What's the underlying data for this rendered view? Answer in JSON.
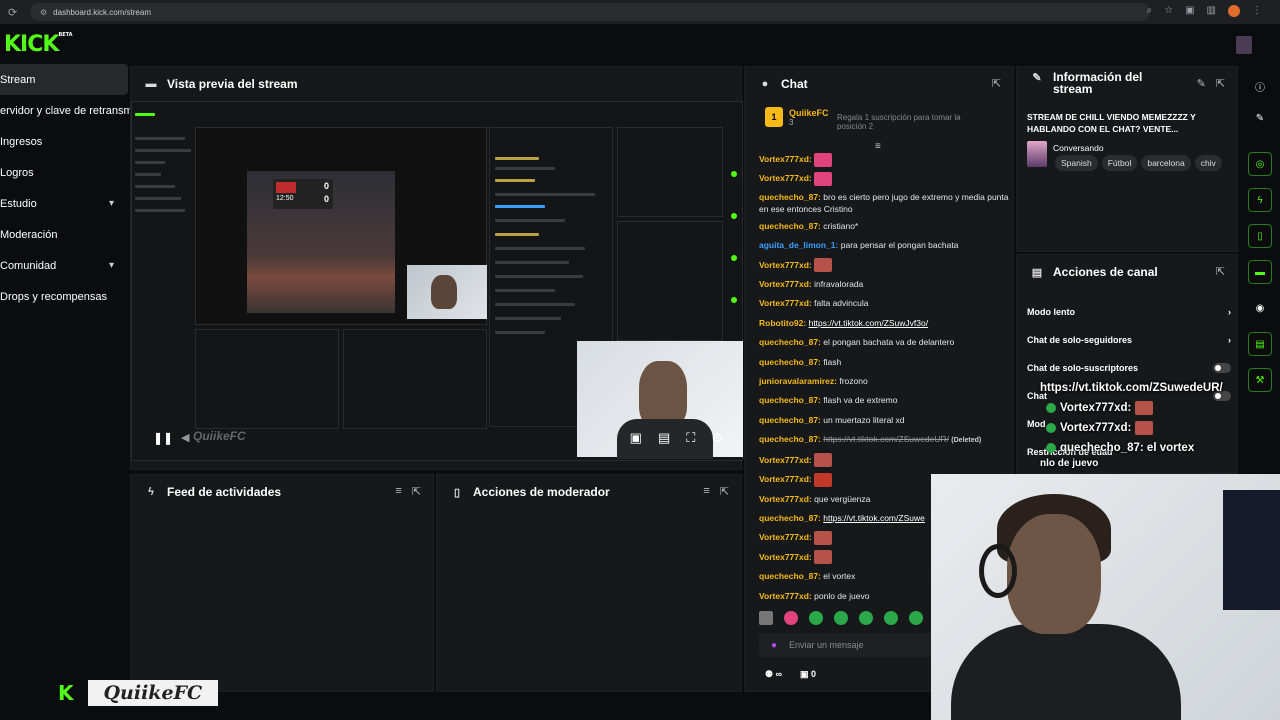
{
  "browser": {
    "url": "dashboard.kick.com/stream"
  },
  "brand": {
    "logo": "KICK",
    "beta": "BETA"
  },
  "sidebar": {
    "items": [
      {
        "label": "Stream",
        "active": true
      },
      {
        "label": "ervidor y clave de retransm"
      },
      {
        "label": "Ingresos"
      },
      {
        "label": "Logros"
      },
      {
        "label": "Estudio",
        "chevron": "▾"
      },
      {
        "label": "Moderación"
      },
      {
        "label": "Comunidad",
        "chevron": "▾"
      },
      {
        "label": "Drops y recompensas"
      }
    ]
  },
  "preview": {
    "title": "Vista previa del stream",
    "watermark": "QuiikeFC",
    "score_a": "0",
    "score_b": "0",
    "time": "12:50"
  },
  "feed": {
    "title": "Feed de actividades"
  },
  "modactions": {
    "title": "Acciones de moderador"
  },
  "chat": {
    "title": "Chat",
    "pinned": {
      "badge": "1",
      "user": "QuiikeFC",
      "count": "3",
      "gift": "Regala 1 suscripción para tomar la posición 2"
    },
    "messages": [
      {
        "user": "Vortex777xd:",
        "color": "#f5b918",
        "text": "",
        "emote": "#e0447a"
      },
      {
        "user": "Vortex777xd:",
        "color": "#f5b918",
        "text": "",
        "emote": "#e0447a"
      },
      {
        "user": "quechecho_87:",
        "color": "#f5b918",
        "text": "bro es cierto pero jugo de extremo y media punta en ese entonces Cristino",
        "wrap": true
      },
      {
        "user": "quechecho_87:",
        "color": "#f5b918",
        "text": "cristiano*"
      },
      {
        "user": "aguita_de_limon_1:",
        "color": "#3aa0ff",
        "text": "para pensar el pongan bachata"
      },
      {
        "user": "Vortex777xd:",
        "color": "#f5b918",
        "text": "",
        "emote": "#b5524a"
      },
      {
        "user": "Vortex777xd:",
        "color": "#f5b918",
        "text": "infravalorada"
      },
      {
        "user": "Vortex777xd:",
        "color": "#f5b918",
        "text": "falta advincula"
      },
      {
        "user": "Robotito92:",
        "color": "#f5b918",
        "text": "https://vt.tiktok.com/ZSuwJvf3o/",
        "link": true
      },
      {
        "user": "quechecho_87:",
        "color": "#f5b918",
        "text": "el pongan bachata va de delantero"
      },
      {
        "user": "quechecho_87:",
        "color": "#f5b918",
        "text": "flash"
      },
      {
        "user": "junioravalaramirez:",
        "color": "#f5b918",
        "text": "frozono"
      },
      {
        "user": "quechecho_87:",
        "color": "#f5b918",
        "text": "flash va de extremo"
      },
      {
        "user": "quechecho_87:",
        "color": "#f5b918",
        "text": "un muertazo literal xd"
      },
      {
        "user": "quechecho_87:",
        "color": "#f5b918",
        "text": "https://vt.tiktok.com/ZSuwedeUR/",
        "deleted": true,
        "tag": "(Deleted)"
      },
      {
        "user": "Vortex777xd:",
        "color": "#f5b918",
        "text": "",
        "emote": "#b5524a"
      },
      {
        "user": "Vortex777xd:",
        "color": "#f5b918",
        "text": "",
        "emote": "#c0392b"
      },
      {
        "user": "Vortex777xd:",
        "color": "#f5b918",
        "text": "que vergüenza"
      },
      {
        "user": "quechecho_87:",
        "color": "#f5b918",
        "text": "https://vt.tiktok.com/ZSuwe",
        "link": true
      },
      {
        "user": "Vortex777xd:",
        "color": "#f5b918",
        "text": "",
        "emote": "#b5524a"
      },
      {
        "user": "Vortex777xd:",
        "color": "#f5b918",
        "text": "",
        "emote": "#b5524a"
      },
      {
        "user": "quechecho_87:",
        "color": "#f5b918",
        "text": "el vortex"
      },
      {
        "user": "Vortex777xd:",
        "color": "#f5b918",
        "text": "ponlo de juevo"
      }
    ],
    "input_placeholder": "Enviar un mensaje",
    "footer_infinity": "∞",
    "footer_count": "0"
  },
  "info": {
    "title": "Información del stream",
    "stream_title": "STREAM DE CHILL VIENDO MEMEZZZZ Y HABLANDO CON EL CHAT? VENTE...",
    "category": "Conversando",
    "tags": [
      "Spanish",
      "Fútbol",
      "barcelona",
      "chiv"
    ]
  },
  "channel": {
    "title": "Acciones de canal",
    "rows": [
      {
        "label": "Modo lento",
        "ctrl": "›"
      },
      {
        "label": "Chat de solo-seguidores",
        "ctrl": "›"
      },
      {
        "label": "Chat de solo-suscriptores",
        "ctrl": "toggle"
      },
      {
        "label": "Chat",
        "ctrl": "toggle"
      },
      {
        "label": "Mod",
        "ctrl": ""
      },
      {
        "label": "Restricción de edad",
        "ctrl": ""
      }
    ]
  },
  "overlay": {
    "lines": [
      {
        "text": "https://vt.tiktok.com/ZSuwedeUR/",
        "check": false
      },
      {
        "text": "Vortex777xd:",
        "check": true
      },
      {
        "text": "Vortex777xd:",
        "check": true
      },
      {
        "text": "quechecho_87: el vortex",
        "check": true
      },
      {
        "text": "nlo de juevo",
        "check": false
      }
    ]
  },
  "streamer": {
    "handle": "QuiikeFC",
    "k": "K"
  }
}
